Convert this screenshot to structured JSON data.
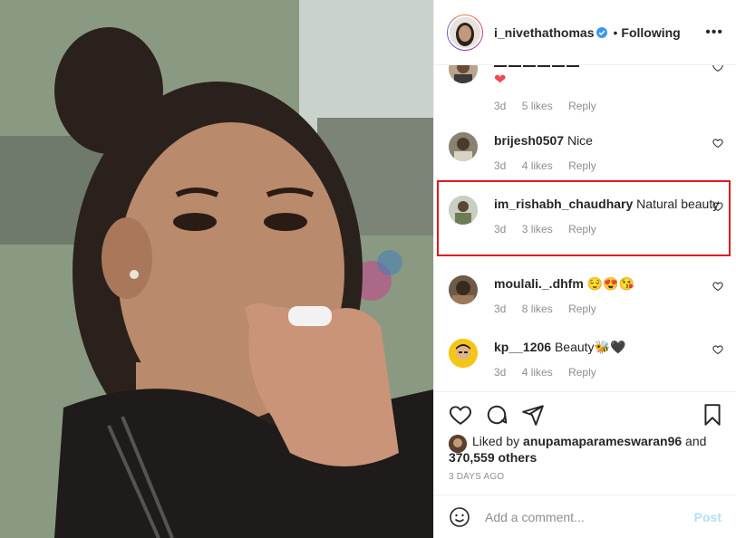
{
  "post": {
    "username": "i_nivethathomas",
    "dot": "•",
    "following": "Following",
    "more": "•••",
    "image_alt": "Woman applying lip balm"
  },
  "comments": [
    {
      "user": "",
      "text": "",
      "emoji": "❤",
      "age": "3d",
      "likes": "5 likes",
      "reply": "Reply"
    },
    {
      "user": "brijesh0507",
      "text": "Nice",
      "age": "3d",
      "likes": "4 likes",
      "reply": "Reply"
    },
    {
      "user": "im_rishabh_chaudhary",
      "text": "Natural beauty",
      "age": "3d",
      "likes": "3 likes",
      "reply": "Reply"
    },
    {
      "user": "moulali._.dhfm",
      "text": "😌😍😘",
      "age": "3d",
      "likes": "8 likes",
      "reply": "Reply"
    },
    {
      "user": "kp__1206",
      "text": "Beauty🐝🖤",
      "age": "3d",
      "likes": "4 likes",
      "reply": "Reply"
    }
  ],
  "liked_by": {
    "prefix": "Liked by ",
    "user": "anupamaparameswaran96",
    "and": " and",
    "count": "370,559 others"
  },
  "time_ago": "3 DAYS AGO",
  "add_comment": {
    "placeholder": "Add a comment...",
    "post_label": "Post"
  },
  "colors": {
    "highlight": "#e01919",
    "verified": "#3897f0",
    "post_disabled": "#b2dffc"
  }
}
